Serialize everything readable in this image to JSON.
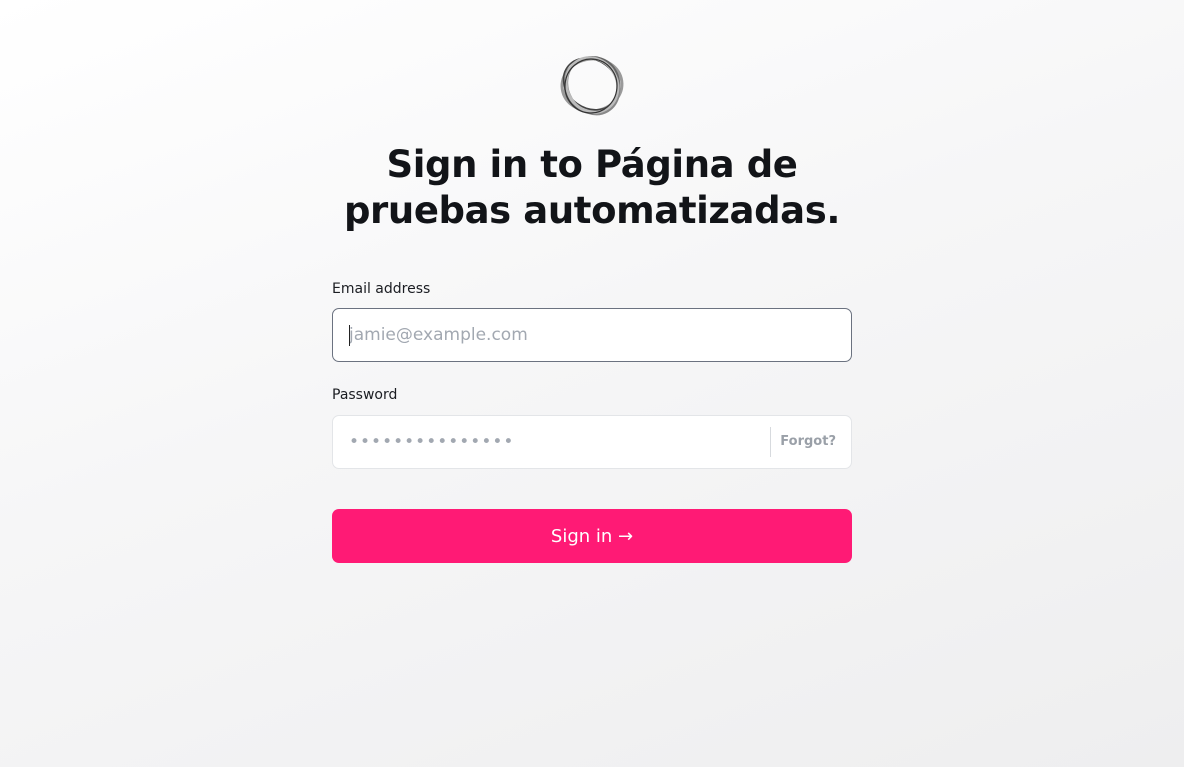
{
  "logo": {
    "icon": "scribble-ring-icon",
    "color": "#555555"
  },
  "heading": {
    "line1": "Sign in to Página de",
    "line2": "pruebas automatizadas."
  },
  "email": {
    "label": "Email address",
    "placeholder": "jamie@example.com",
    "value": ""
  },
  "password": {
    "label": "Password",
    "placeholder": "•••••••••••••••",
    "value": "",
    "forgot_label": "Forgot?"
  },
  "signin": {
    "label": "Sign in →",
    "color": "#ff1a75"
  }
}
